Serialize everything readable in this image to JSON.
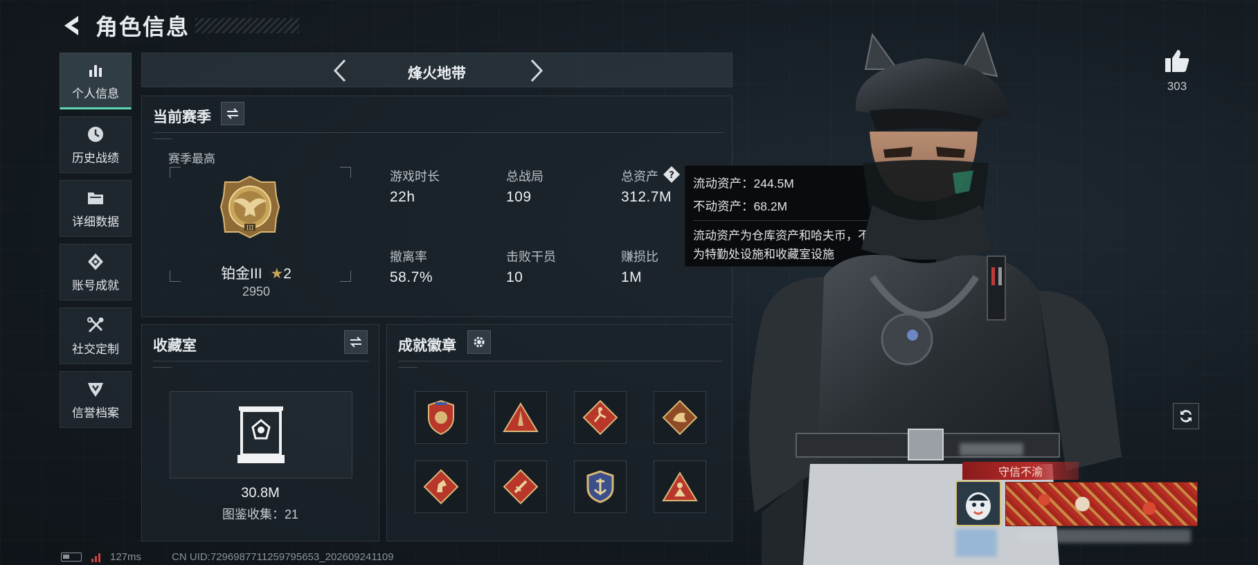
{
  "header": {
    "title": "角色信息"
  },
  "sidebar": {
    "items": [
      {
        "label": "个人信息",
        "icon": "bar-chart-icon",
        "active": true
      },
      {
        "label": "历史战绩",
        "icon": "clock-icon",
        "active": false
      },
      {
        "label": "详细数据",
        "icon": "folder-icon",
        "active": false
      },
      {
        "label": "账号成就",
        "icon": "achievement-icon",
        "active": false
      },
      {
        "label": "社交定制",
        "icon": "tools-icon",
        "active": false
      },
      {
        "label": "信誉档案",
        "icon": "shield-icon",
        "active": false
      }
    ]
  },
  "mode": {
    "label": "烽火地带"
  },
  "season": {
    "title": "当前赛季",
    "best_label": "赛季最高",
    "rank_name": "铂金III",
    "rank_stars": "2",
    "rank_points": "2950",
    "stats": [
      {
        "label": "游戏时长",
        "value": "22h"
      },
      {
        "label": "总战局",
        "value": "109"
      },
      {
        "label": "总资产",
        "value": "312.7M"
      },
      {
        "label": "撤离率",
        "value": "58.7%"
      },
      {
        "label": "击败干员",
        "value": "10"
      },
      {
        "label": "赚损比",
        "value": "1M"
      }
    ]
  },
  "tooltip": {
    "liquid": "流动资产：244.5M",
    "fixed": "不动资产：68.2M",
    "description_line1": "流动资产为仓库资产和哈夫币，不动资产",
    "description_line2": "为特勤处设施和收藏室设施"
  },
  "collection": {
    "title": "收藏室",
    "value": "30.8M",
    "collected": "图鉴收集：21"
  },
  "badges": {
    "title": "成就徽章",
    "items": [
      "badge-shield-icon",
      "badge-rocket-icon",
      "badge-runner-icon",
      "badge-dragon-icon",
      "badge-horse-icon",
      "badge-sword-icon",
      "badge-anchor-icon",
      "badge-soldier-icon"
    ]
  },
  "likes": {
    "count": "303"
  },
  "credit": {
    "label": "守信不渝"
  },
  "footer": {
    "ping": "127ms",
    "uid": "CN UID:7296987711259795653_202609241109"
  },
  "colors": {
    "accent": "#5fd9b3",
    "gold": "#c9a55a",
    "banner_red": "#b62a2a"
  }
}
